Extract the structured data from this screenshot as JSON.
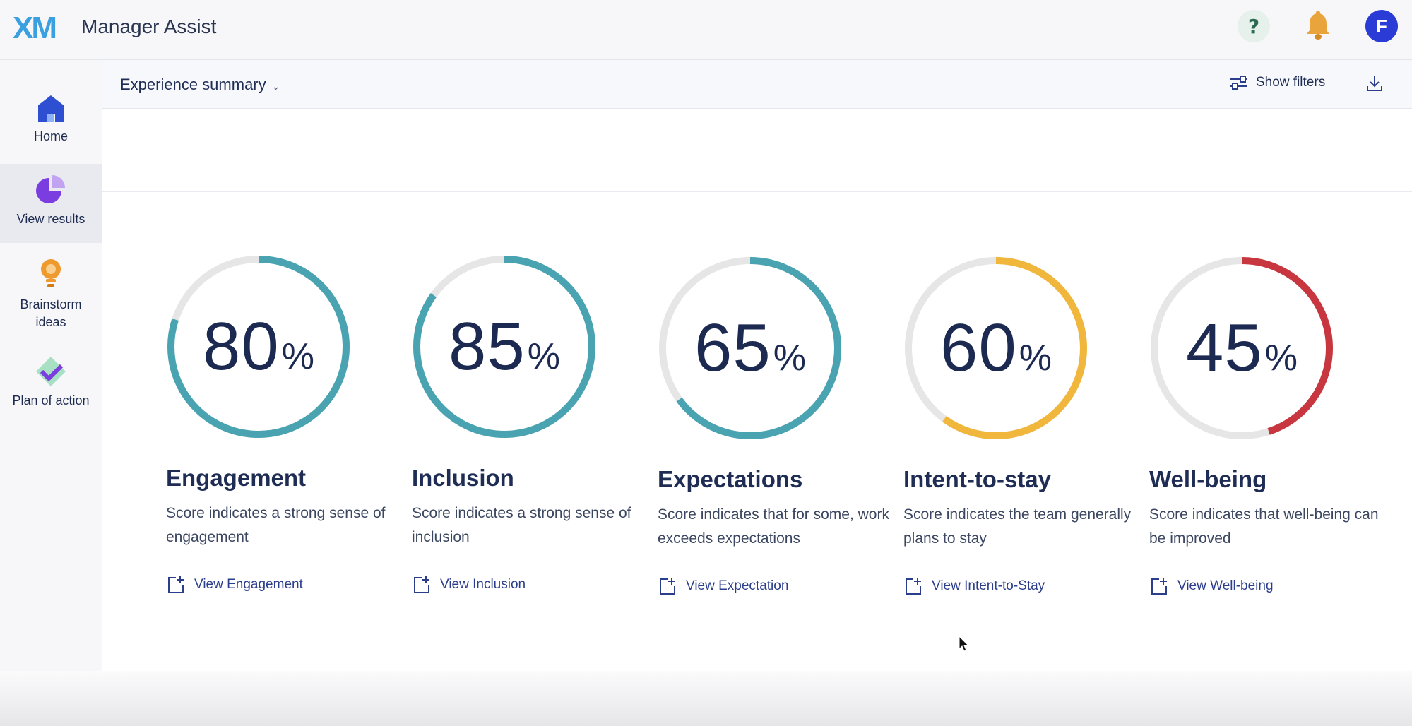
{
  "header": {
    "logo_text": "XM",
    "app_title": "Manager Assist",
    "help_label": "?",
    "avatar_initial": "F"
  },
  "sidebar": {
    "items": [
      {
        "label": "Home",
        "icon": "home-icon",
        "active": false
      },
      {
        "label": "View results",
        "icon": "pie-chart-icon",
        "active": true
      },
      {
        "label": "Brainstorm ideas",
        "icon": "lightbulb-icon",
        "active": false
      },
      {
        "label": "Plan of action",
        "icon": "diamond-check-icon",
        "active": false
      }
    ]
  },
  "toolbar": {
    "summary_label": "Experience summary",
    "show_filters_label": "Show filters",
    "download_icon": "download-icon"
  },
  "cards": [
    {
      "score": 80,
      "score_text": "80",
      "title": "Engagement",
      "description": "Score indicates a strong sense of engagement",
      "link": "View Engagement",
      "color": "#4aa3b1"
    },
    {
      "score": 85,
      "score_text": "85",
      "title": "Inclusion",
      "description": "Score indicates a strong sense of inclusion",
      "link": "View Inclusion",
      "color": "#4aa3b1"
    },
    {
      "score": 65,
      "score_text": "65",
      "title": "Expectations",
      "description": "Score indicates that for some, work exceeds expectations",
      "link": "View Expectation",
      "color": "#4aa3b1"
    },
    {
      "score": 60,
      "score_text": "60",
      "title": "Intent-to-stay",
      "description": "Score indicates the team generally plans to stay",
      "link": "View Intent-to-Stay",
      "color": "#f0b73c"
    },
    {
      "score": 45,
      "score_text": "45",
      "title": "Well-being",
      "description": "Score indicates that well-being can be improved",
      "link": "View Well-being",
      "color": "#c8373f"
    }
  ],
  "percent_sign": "%",
  "colors": {
    "track": "#e6e6e6",
    "teal": "#4aa3b1",
    "amber": "#f0b73c",
    "red": "#c8373f",
    "accent": "#2b3bd6"
  }
}
